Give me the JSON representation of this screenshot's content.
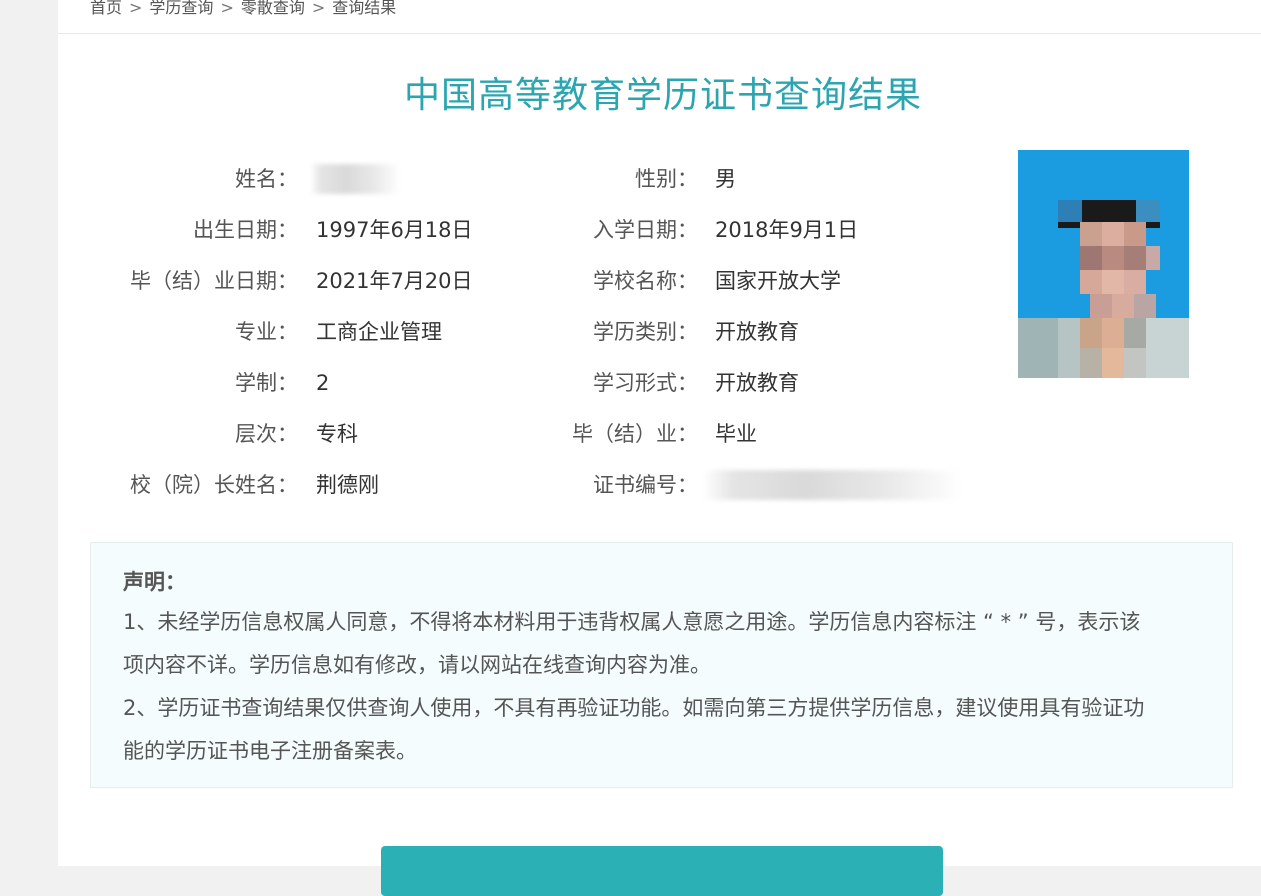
{
  "breadcrumb": {
    "items": [
      "首页",
      "学历查询",
      "零散查询",
      "查询结果"
    ],
    "separator": ">"
  },
  "page_title": "中国高等教育学历证书查询结果",
  "fields": {
    "name": {
      "label": "姓名：",
      "value": ""
    },
    "gender": {
      "label": "性别：",
      "value": "男"
    },
    "birth_date": {
      "label": "出生日期：",
      "value": "1997年6月18日"
    },
    "enroll_date": {
      "label": "入学日期：",
      "value": "2018年9月1日"
    },
    "graduation_date": {
      "label": "毕（结）业日期：",
      "value": "2021年7月20日"
    },
    "school_name": {
      "label": "学校名称：",
      "value": "国家开放大学"
    },
    "major": {
      "label": "专业：",
      "value": "工商企业管理"
    },
    "education_type": {
      "label": "学历类别：",
      "value": "开放教育"
    },
    "duration": {
      "label": "学制：",
      "value": "2"
    },
    "study_form": {
      "label": "学习形式：",
      "value": "开放教育"
    },
    "level": {
      "label": "层次：",
      "value": "专科"
    },
    "graduation_status": {
      "label": "毕（结）业：",
      "value": "毕业"
    },
    "president_name": {
      "label": "校（院）长姓名：",
      "value": "荆德刚"
    },
    "certificate_no": {
      "label": "证书编号：",
      "value": ""
    }
  },
  "notice": {
    "heading": "声明：",
    "lines": [
      "1、未经学历信息权属人同意，不得将本材料用于违背权属人意愿之用途。学历信息内容标注 “ * ” 号，表示该",
      "项内容不详。学历信息如有修改，请以网站在线查询内容为准。",
      "2、学历证书查询结果仅供查询人使用，不具有再验证功能。如需向第三方提供学历信息，建议使用具有验证功",
      "能的学历证书电子注册备案表。"
    ]
  },
  "photo": {
    "icon": "person-photo",
    "background_color": "#1b9ce0"
  },
  "colors": {
    "accent": "#2ba6b0",
    "button": "#2bb0b6",
    "notice_bg": "#f5fcfd"
  },
  "action_button": {
    "label": ""
  }
}
